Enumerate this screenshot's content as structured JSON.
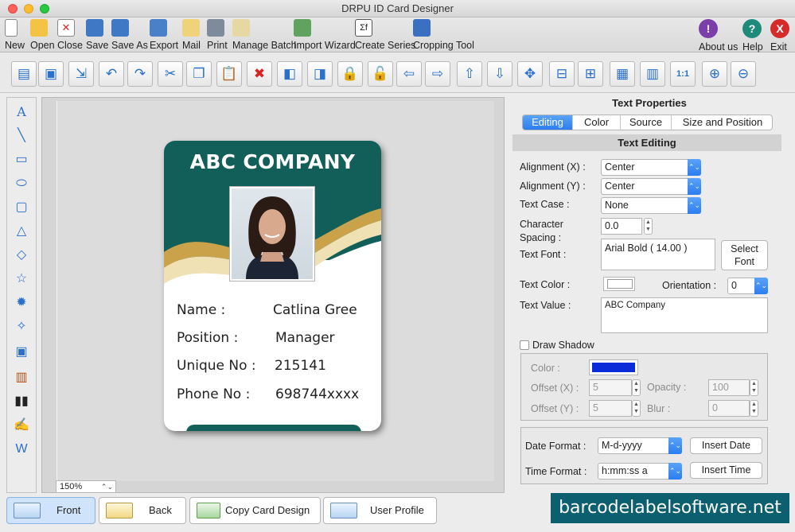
{
  "window": {
    "title": "DRPU ID Card Designer"
  },
  "toolbar_top": {
    "new": "New",
    "open": "Open",
    "close": "Close",
    "save": "Save",
    "save_as": "Save As",
    "export": "Export",
    "mail": "Mail",
    "print": "Print",
    "manage_batch": "Manage Batch",
    "import_wizard": "Import Wizard",
    "create_series": "Create Series",
    "cropping_tool": "Cropping Tool",
    "about_us": "About us",
    "help": "Help",
    "exit": "Exit"
  },
  "card": {
    "company": "ABC COMPANY",
    "fields": [
      {
        "label": "Name :",
        "value": "Catlina Gree"
      },
      {
        "label": "Position :",
        "value": "Manager"
      },
      {
        "label": "Unique No :",
        "value": "215141"
      },
      {
        "label": "Phone No :",
        "value": "698744xxxx"
      }
    ],
    "colors": {
      "band": "#125e58",
      "gold": "#c9a24a"
    }
  },
  "zoom": "150%",
  "panel": {
    "title": "Text Properties",
    "tabs": [
      "Editing",
      "Color",
      "Source",
      "Size and Position"
    ],
    "active_tab": "Editing",
    "section": "Text Editing",
    "alignment_x_label": "Alignment (X) :",
    "alignment_x": "Center",
    "alignment_y_label": "Alignment (Y) :",
    "alignment_y": "Center",
    "text_case_label": "Text Case :",
    "text_case": "None",
    "char_spacing_label_1": "Character",
    "char_spacing_label_2": "Spacing :",
    "char_spacing": "0.0",
    "text_font_label": "Text Font :",
    "text_font": "Arial Bold ( 14.00 )",
    "select_font_1": "Select",
    "select_font_2": "Font",
    "text_color_label": "Text Color :",
    "text_color": "#ffffff",
    "orientation_label": "Orientation :",
    "orientation": "0",
    "text_value_label": "Text Value :",
    "text_value": "ABC Company",
    "draw_shadow": "Draw Shadow",
    "shadow_color_label": "Color :",
    "shadow_color": "#0a2bd8",
    "offset_x_label": "Offset (X) :",
    "offset_x": "5",
    "offset_y_label": "Offset (Y) :",
    "offset_y": "5",
    "opacity_label": "Opacity :",
    "opacity": "100",
    "blur_label": "Blur :",
    "blur": "0",
    "date_format_label": "Date Format :",
    "date_format": "M-d-yyyy",
    "insert_date": "Insert Date",
    "time_format_label": "Time Format :",
    "time_format": "h:mm:ss a",
    "insert_time": "Insert Time"
  },
  "bottom": {
    "front": "Front",
    "back": "Back",
    "copy_card_design": "Copy Card Design",
    "user_profile": "User Profile",
    "brand": "barcodelabelsoftware.net"
  }
}
